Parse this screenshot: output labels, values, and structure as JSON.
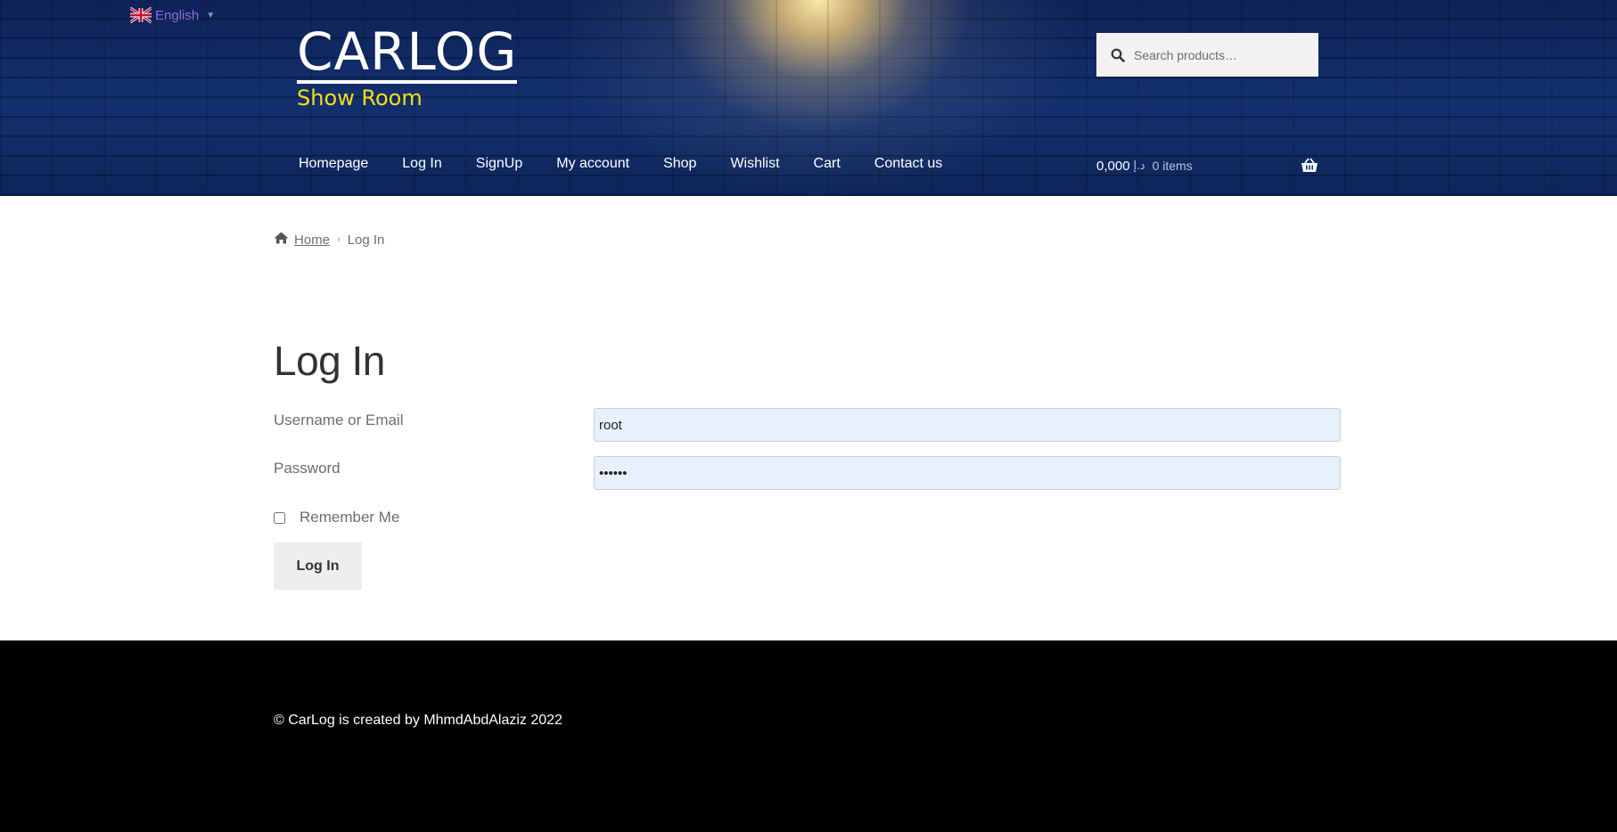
{
  "language": {
    "label": "English",
    "flag": "uk-flag-icon"
  },
  "site": {
    "title": "CARLOG",
    "tagline": "Show Room"
  },
  "search": {
    "placeholder": "Search products…"
  },
  "nav": {
    "items": [
      {
        "label": "Homepage"
      },
      {
        "label": "Log In"
      },
      {
        "label": "SignUp"
      },
      {
        "label": "My account"
      },
      {
        "label": "Shop"
      },
      {
        "label": "Wishlist"
      },
      {
        "label": "Cart"
      },
      {
        "label": "Contact us"
      }
    ]
  },
  "cart": {
    "amount": "0,000",
    "currency": "د.إ",
    "count": "0 items"
  },
  "breadcrumb": {
    "home": "Home",
    "current": "Log In"
  },
  "page": {
    "title": "Log In"
  },
  "form": {
    "username_label": "Username or Email",
    "username_value": "root",
    "password_label": "Password",
    "password_value": "••••••",
    "remember_label": "Remember Me",
    "remember_checked": false,
    "submit_label": "Log In"
  },
  "footer": {
    "copyright": "© CarLog is created by MhmdAbdAlaziz 2022"
  },
  "colors": {
    "header_bg": "#13306e",
    "tagline": "#f3df18",
    "footer_bg": "#000000",
    "input_bg": "#e8f0fe"
  }
}
